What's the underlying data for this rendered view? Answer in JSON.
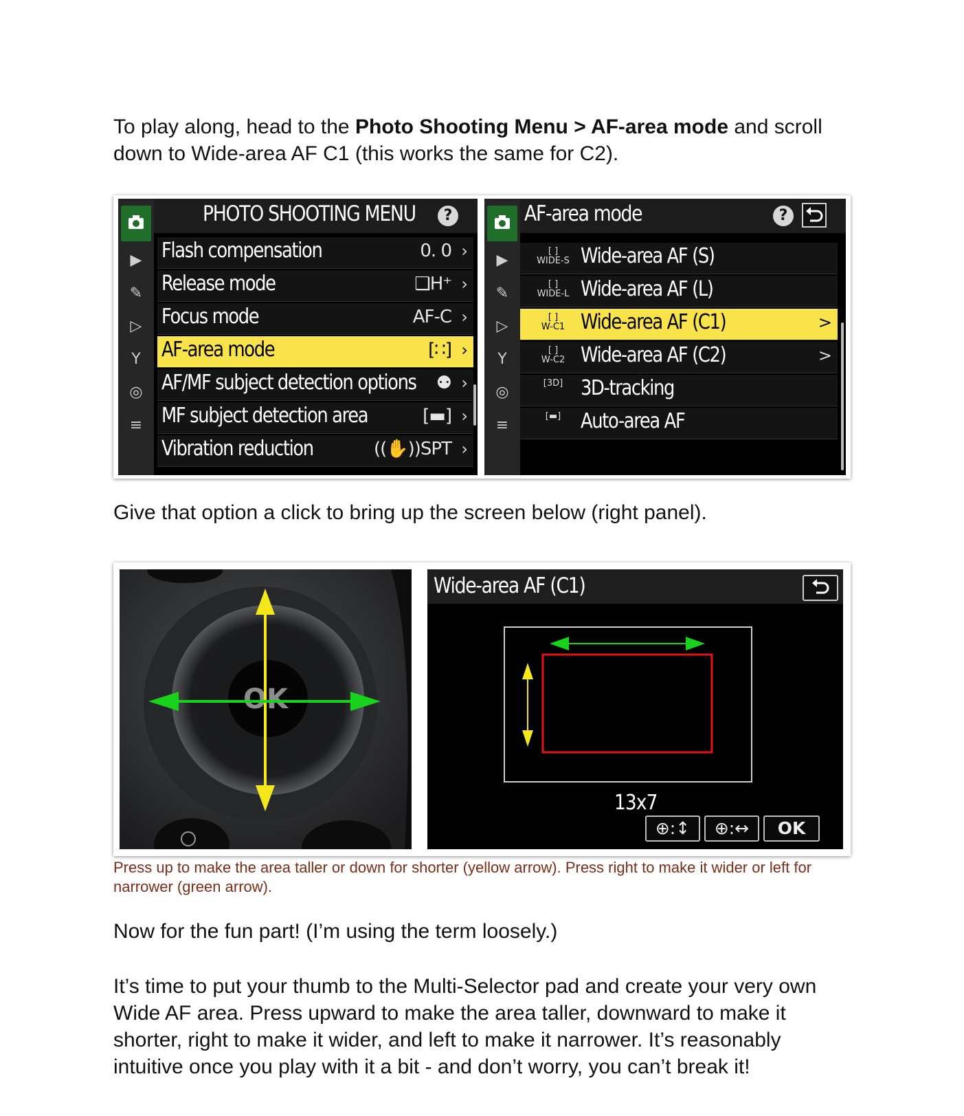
{
  "intro": {
    "pre": "To play along, head to the ",
    "bold": "Photo Shooting Menu > AF-area mode",
    "post": " and scroll down to Wide-area AF C1 (this works the same for C2)."
  },
  "menu1": {
    "title": "PHOTO SHOOTING MENU",
    "help": "?",
    "items": [
      {
        "label": "Flash compensation",
        "value": "0. 0"
      },
      {
        "label": "Release mode",
        "value": "❑H⁺"
      },
      {
        "label": "Focus mode",
        "value": "AF-C"
      },
      {
        "label": "AF-area mode",
        "value": "[∷]"
      },
      {
        "label": "AF/MF subject detection options",
        "value": "⚉"
      },
      {
        "label": "MF subject detection area",
        "value": "[▬]"
      },
      {
        "label": "Vibration reduction",
        "value": "((✋))SPT"
      }
    ],
    "selected_index": 3
  },
  "menu2": {
    "title": "AF-area mode",
    "help": "?",
    "items": [
      {
        "icon": "[ ]\nWIDE-S",
        "label": "Wide-area AF (S)",
        "chevron": ""
      },
      {
        "icon": "[ ]\nWIDE-L",
        "label": "Wide-area AF (L)",
        "chevron": ""
      },
      {
        "icon": "[ ]\nW-C1",
        "label": "Wide-area AF (C1)",
        "chevron": ">"
      },
      {
        "icon": "[ ]\nW-C2",
        "label": "Wide-area AF (C2)",
        "chevron": ">"
      },
      {
        "icon": "[3D]",
        "label": "3D-tracking",
        "chevron": ""
      },
      {
        "icon": "[▬]",
        "label": "Auto-area AF",
        "chevron": ""
      }
    ],
    "selected_index": 2
  },
  "para2": "Give that option a click to bring up the screen below (right panel).",
  "screen2": {
    "title": "Wide-area AF (C1)",
    "size": "13x7",
    "buttons": [
      "⊕:↕",
      "⊕:↔",
      "OK"
    ],
    "dial_label": "OK"
  },
  "caption": "Press up to make the area taller or down for shorter (yellow arrow). Press right to make it wider or left for narrower (green arrow).",
  "para3": "Now for the fun part! (I’m using the term loosely.)",
  "para4": "It’s time to put your thumb to the Multi-Selector pad and create your very own Wide AF area. Press upward to make the area taller, downward to make it shorter, right to make it wider, and left to make it narrower. It’s reasonably intuitive once you play with it a bit - and don’t worry, you can’t break it!",
  "colors": {
    "highlight": "#f9e34a",
    "arrow_yellow": "#f4e81b",
    "arrow_green": "#19d21c",
    "frame_red": "#e01616",
    "caption": "#7a2e17"
  }
}
